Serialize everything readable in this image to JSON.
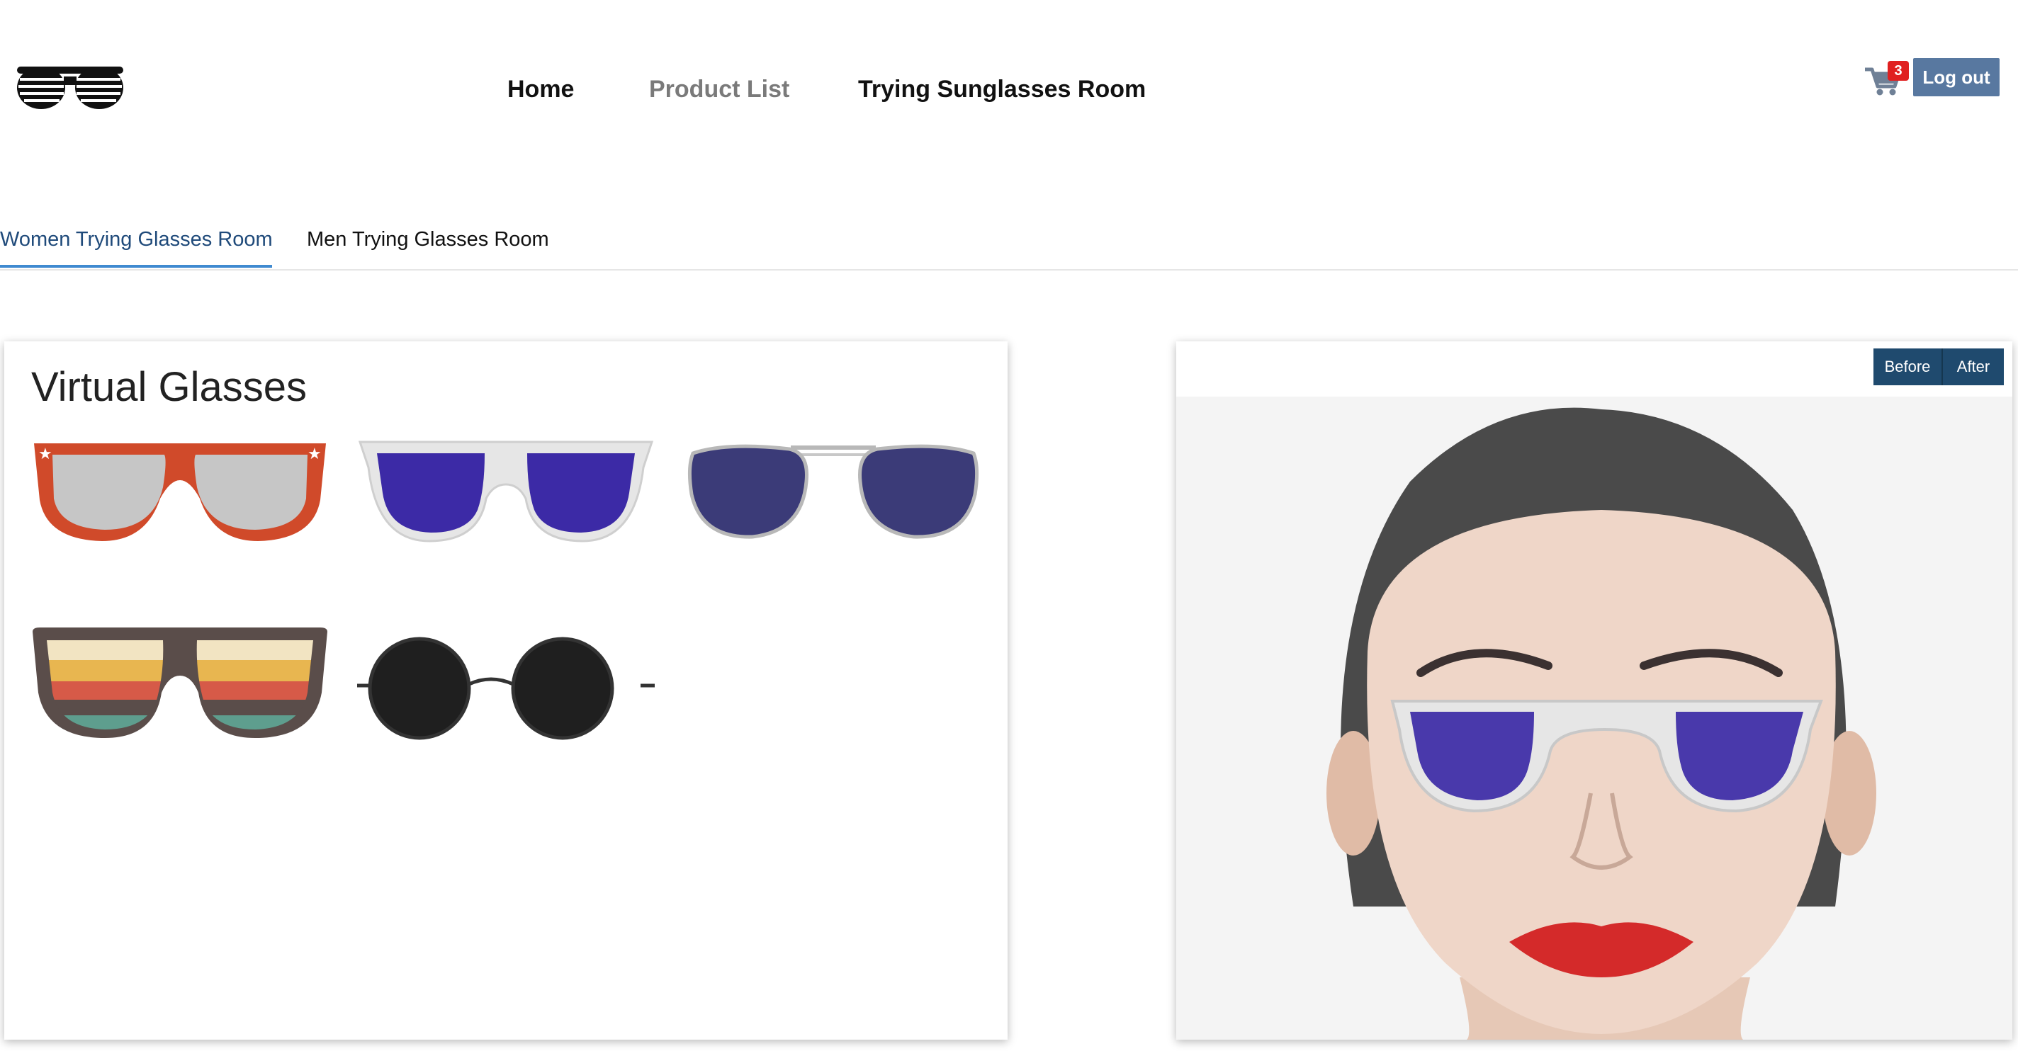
{
  "navbar": {
    "logo_icon": "shutter-shades-logo",
    "links": [
      {
        "label": "Home"
      },
      {
        "label": "Product List"
      },
      {
        "label": "Trying Sunglasses Room"
      }
    ],
    "cart": {
      "icon": "cart-icon",
      "count": "3"
    },
    "logout_label": "Log out"
  },
  "tabs": [
    {
      "label": "Women Trying Glasses Room",
      "active": true
    },
    {
      "label": "Men Trying Glasses Room",
      "active": false
    }
  ],
  "catalog": {
    "title": "Virtual Glasses",
    "items": [
      {
        "name": "red-wayfarer-sunglasses-icon",
        "frame_color": "#d04a2a",
        "lens_color": "#c6c6c6"
      },
      {
        "name": "white-frame-purple-lens-sunglasses-icon",
        "frame_color": "#e4e4e4",
        "lens_color": "#3c2aa6"
      },
      {
        "name": "navy-aviator-sunglasses-icon",
        "frame_color": "#b8b8b8",
        "lens_color": "#3b3b78"
      },
      {
        "name": "striped-lens-sunglasses-icon",
        "frame_color": "#5a4d4a",
        "lens_color": "#e8b650"
      },
      {
        "name": "round-black-sunglasses-icon",
        "frame_color": "#333333",
        "lens_color": "#1f1f1f"
      }
    ]
  },
  "preview": {
    "before_label": "Before",
    "after_label": "After",
    "selected_glasses_lens": "#3c2aa6",
    "lip_color": "#d42a2a"
  }
}
